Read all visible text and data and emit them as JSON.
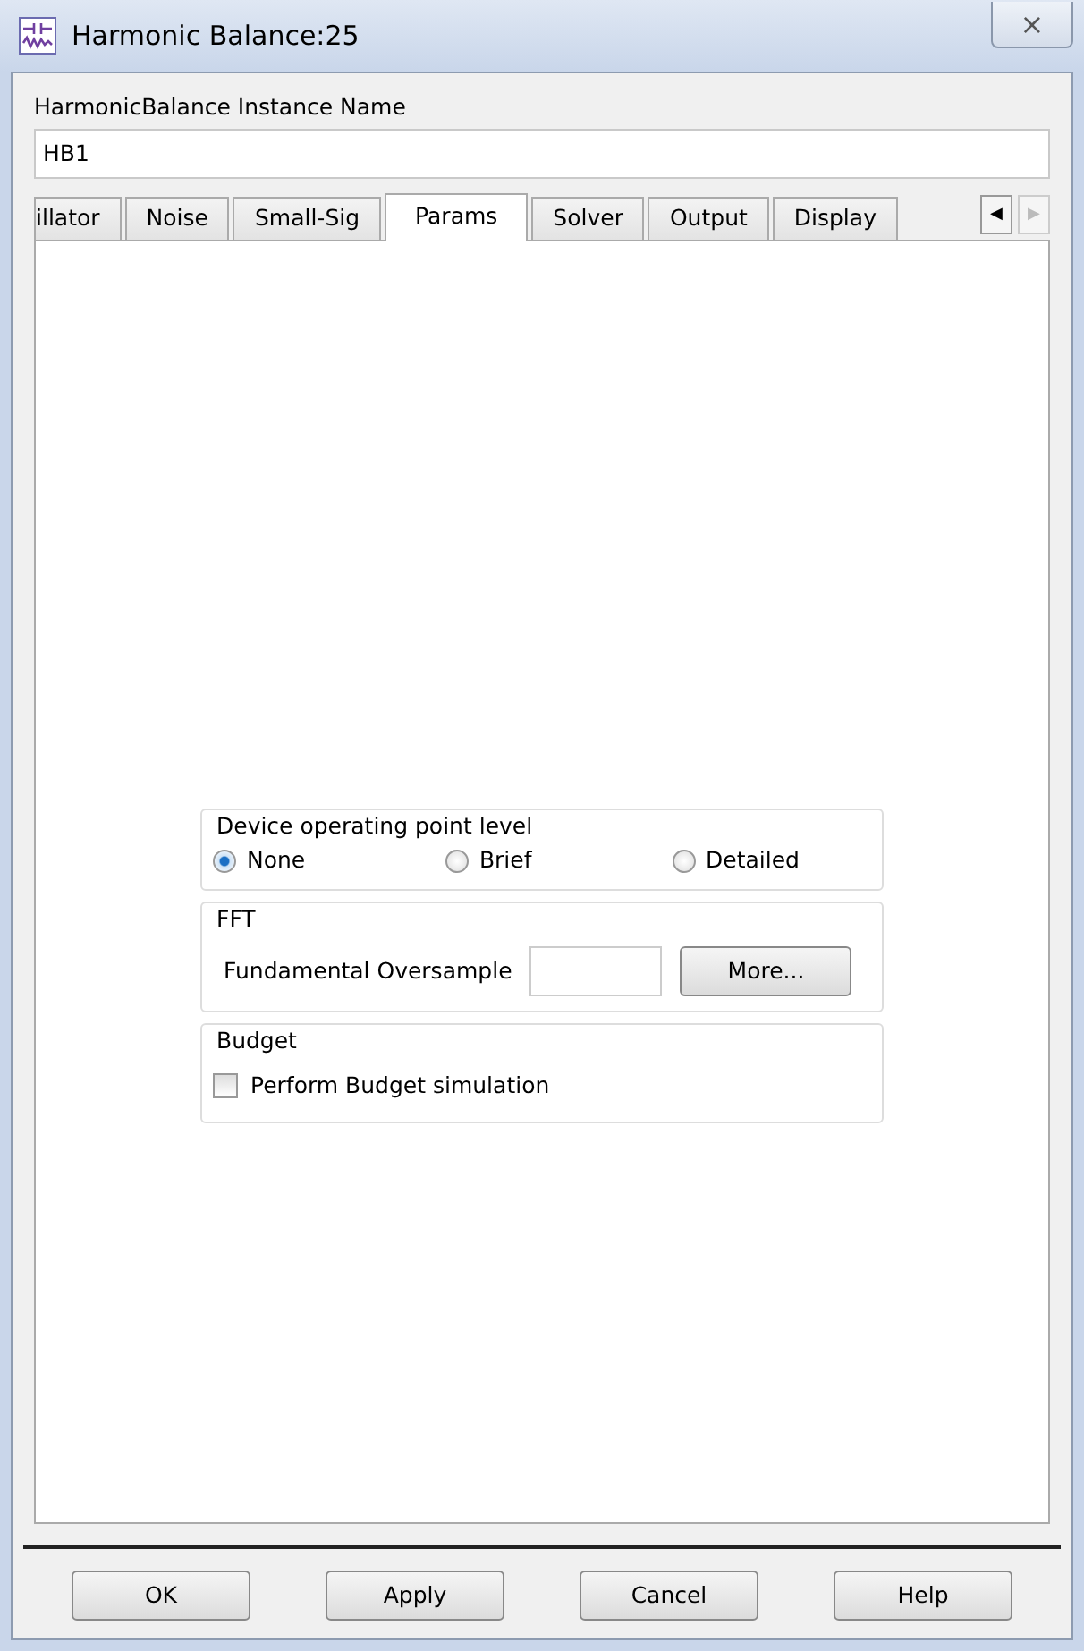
{
  "window": {
    "title": "Harmonic Balance:25",
    "close": "⨯"
  },
  "instance_name": {
    "label": "HarmonicBalance Instance Name",
    "value": "HB1"
  },
  "tabs": [
    {
      "label": "illator",
      "selected": false
    },
    {
      "label": "Noise",
      "selected": false
    },
    {
      "label": "Small-Sig",
      "selected": false
    },
    {
      "label": "Params",
      "selected": true
    },
    {
      "label": "Solver",
      "selected": false
    },
    {
      "label": "Output",
      "selected": false
    },
    {
      "label": "Display",
      "selected": false
    }
  ],
  "tab_scroll": [
    {
      "glyph": "◀",
      "disabled": false
    },
    {
      "glyph": "▶",
      "disabled": true
    }
  ],
  "groups": [
    {
      "kind": "radios",
      "title": "Device operating point level",
      "options": [
        {
          "label": "None",
          "selected": true
        },
        {
          "label": "Brief",
          "selected": false
        },
        {
          "label": "Detailed",
          "selected": false
        }
      ]
    },
    {
      "kind": "field",
      "title": "FFT",
      "label": "Fundamental Oversample",
      "button": "More..."
    },
    {
      "kind": "checkbox",
      "title": "Budget",
      "label": "Perform Budget simulation",
      "checked": false
    }
  ],
  "buttons": [
    "OK",
    "Apply",
    "Cancel",
    "Help"
  ]
}
